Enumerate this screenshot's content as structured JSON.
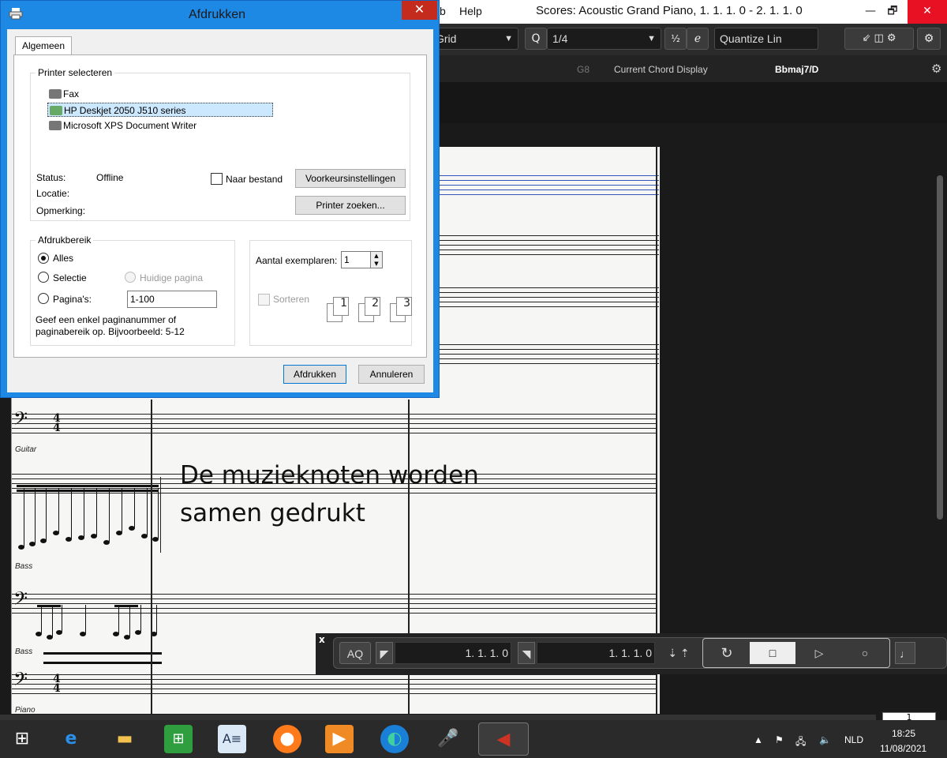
{
  "app": {
    "menu_items": [
      "b",
      "Help"
    ],
    "title": "Scores: Acoustic Grand Piano, 1. 1. 1.  0 - 2. 1. 1.  0",
    "win_min": "—",
    "win_max": "🗗",
    "win_close": "✕"
  },
  "toolbar": {
    "grid_label": "Grid",
    "quantize_label": "1/4",
    "quantize_mode": "Quantize Lin",
    "q_icon": "Q",
    "ex_icon": "⅟₂",
    "e_icon": "ℯ"
  },
  "chord_display": {
    "g8": "G8",
    "label": "Current Chord Display",
    "chord": "Bbmaj7/D"
  },
  "score": {
    "instruments": [
      "Guitar",
      "Bass",
      "Bass",
      "Piano"
    ],
    "time_sig": [
      "4",
      "4"
    ]
  },
  "caption": "De muzieknoten worden samen gedrukt",
  "transport": {
    "close": "x",
    "aq": "AQ",
    "left_locator": "1.  1.  1.     0",
    "right_locator": "1.  1.  1.     0",
    "page_number": "1"
  },
  "print_dialog": {
    "title": "Afdrukken",
    "tab": "Algemeen",
    "printer_group": "Printer selecteren",
    "printers": [
      "Fax",
      "HP Deskjet 2050 J510 series",
      "Microsoft XPS Document Writer"
    ],
    "selected_printer_index": 1,
    "status_label": "Status:",
    "status_value": "Offline",
    "location_label": "Locatie:",
    "comment_label": "Opmerking:",
    "to_file_label": "Naar bestand",
    "preferences_button": "Voorkeursinstellingen",
    "find_printer_button": "Printer zoeken...",
    "range_group": "Afdrukbereik",
    "range_all": "Alles",
    "range_selection": "Selectie",
    "range_current": "Huidige pagina",
    "range_pages": "Pagina's:",
    "pages_value": "1-100",
    "range_hint_1": "Geef een enkel paginanummer of",
    "range_hint_2": "paginabereik op. Bijvoorbeeld: 5-12",
    "copies_label": "Aantal exemplaren:",
    "copies_value": "1",
    "collate_label": "Sorteren",
    "print_button": "Afdrukken",
    "cancel_button": "Annuleren"
  },
  "taskbar": {
    "language": "NLD",
    "time": "18:25",
    "date": "11/08/2021"
  }
}
